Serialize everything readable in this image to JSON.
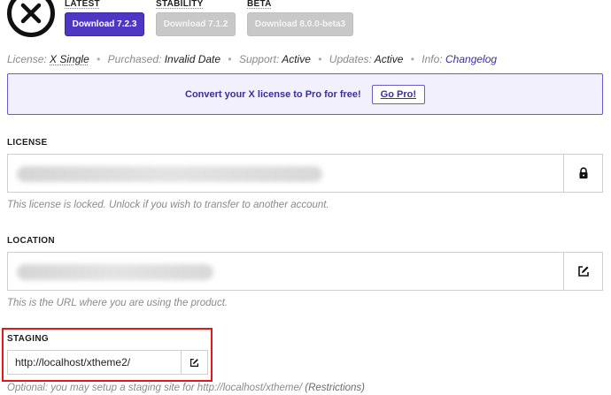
{
  "channels": [
    {
      "label": "LATEST",
      "button": "Download 7.2.3",
      "style": "primary"
    },
    {
      "label": "STABILITY",
      "button": "Download 7.1.2",
      "style": "muted"
    },
    {
      "label": "BETA",
      "button": "Download 8.0.0-beta3",
      "style": "muted"
    }
  ],
  "info": {
    "license_label": "License:",
    "license_value": "X Single",
    "purchased_label": "Purchased:",
    "purchased_value": "Invalid Date",
    "support_label": "Support:",
    "support_value": "Active",
    "updates_label": "Updates:",
    "updates_value": "Active",
    "info_label": "Info:",
    "info_value": "Changelog",
    "separator": "•"
  },
  "promo": {
    "text": "Convert your X license to Pro for free!",
    "button": "Go Pro!"
  },
  "license": {
    "label": "LICENSE",
    "hint": "This license is locked. Unlock if you wish to transfer to another account.",
    "action_icon": "lock-icon"
  },
  "location": {
    "label": "LOCATION",
    "hint": "This is the URL where you are using the product.",
    "action_icon": "edit-icon"
  },
  "staging": {
    "label": "STAGING",
    "value": "http://localhost/xtheme2/",
    "hint_prefix": "Optional: you may setup a staging site for",
    "hint_url": "http://localhost/xtheme/",
    "hint_link": "(Restrictions)",
    "action_icon": "edit-icon"
  },
  "colors": {
    "accent": "#4f36c3",
    "promo_bg": "#f2f0fd",
    "highlight": "#e01818"
  }
}
